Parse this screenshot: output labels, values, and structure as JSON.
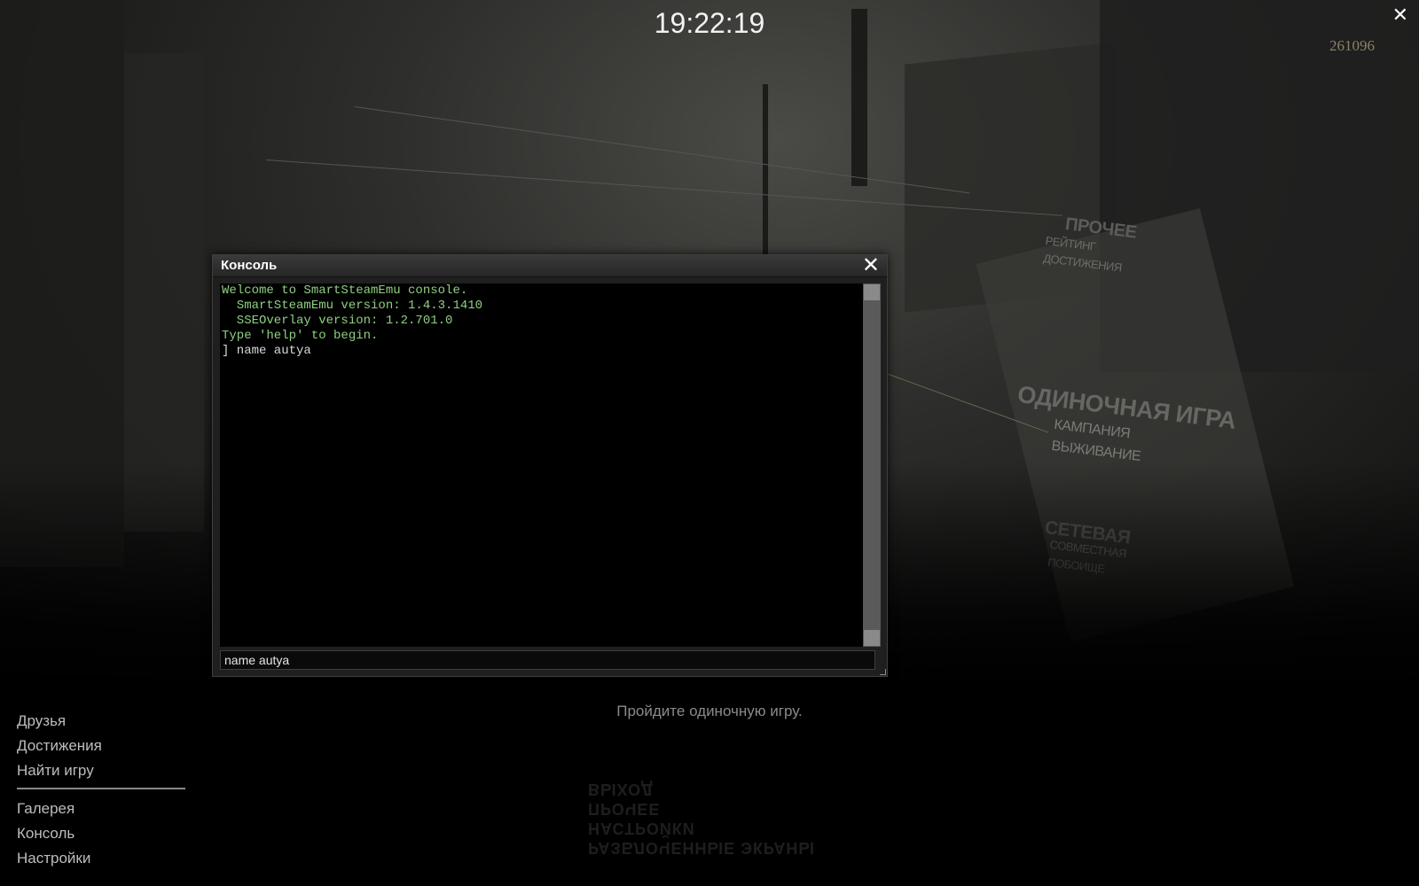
{
  "clock": "19:22:19",
  "coins": "261096",
  "scene_menu": {
    "misc_header": "ПРОЧЕЕ",
    "misc_items": [
      "РЕЙТИНГ",
      "ДОСТИЖЕНИЯ"
    ],
    "single_header": "ОДИНОЧНАЯ ИГРА",
    "single_items": [
      "КАМПАНИЯ",
      "ВЫЖИВАНИЕ"
    ],
    "network_header": "СЕТЕВАЯ",
    "network_items": [
      "СОВМЕСТНАЯ",
      "ПОБОИЩЕ"
    ]
  },
  "console": {
    "title": "Консоль",
    "close_icon": "close-icon",
    "lines": [
      {
        "text": "Welcome to SmartSteamEmu console.",
        "color": "#8fcf82"
      },
      {
        "text": "  SmartSteamEmu version: 1.4.3.1410",
        "color": "#8fcf82"
      },
      {
        "text": "  SSEOverlay version: 1.2.701.0",
        "color": "#8fcf82"
      },
      {
        "text": "Type 'help' to begin.",
        "color": "#8fcf82"
      },
      {
        "text": "] name autya",
        "color": "#d8d8d8"
      }
    ],
    "input_value": "name autya"
  },
  "hint": "Пройдите одиночную игру.",
  "left_menu": {
    "top": [
      "Друзья",
      "Достижения",
      "Найти игру"
    ],
    "bottom": [
      "Галерея",
      "Консоль",
      "Настройки"
    ]
  },
  "mirrored_menu": [
    "ВЫХОД",
    "ПРОЧЕЕ",
    "НАСТРОЙКИ",
    "РАЗБЛОЧЕННЫЕ ЭКРАНЫ"
  ],
  "colors": {
    "console_green": "#8fcf82",
    "coins": "#8b8266"
  }
}
